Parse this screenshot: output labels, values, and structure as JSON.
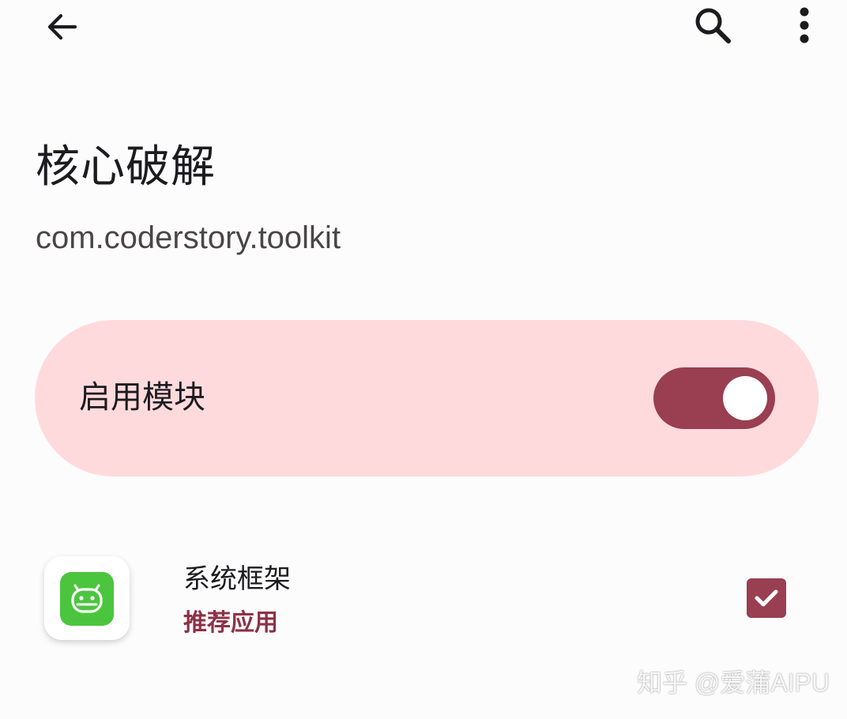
{
  "app_bar": {
    "back_icon": "arrow-back-icon",
    "search_icon": "search-icon",
    "more_icon": "more-vert-icon"
  },
  "module": {
    "title": "核心破解",
    "package": "com.coderstory.toolkit"
  },
  "enable_card": {
    "label": "启用模块",
    "enabled": true
  },
  "scope_list": [
    {
      "name": "系统框架",
      "tag": "推荐应用",
      "icon": "android-icon",
      "checked": true
    }
  ],
  "watermark": "知乎 @爱蒲AIPU",
  "colors": {
    "background": "#fcfcfc",
    "card": "#ffdadd",
    "accent": "#9a3e52",
    "tag": "#8c3248",
    "app_icon_green": "#4bc53e"
  }
}
